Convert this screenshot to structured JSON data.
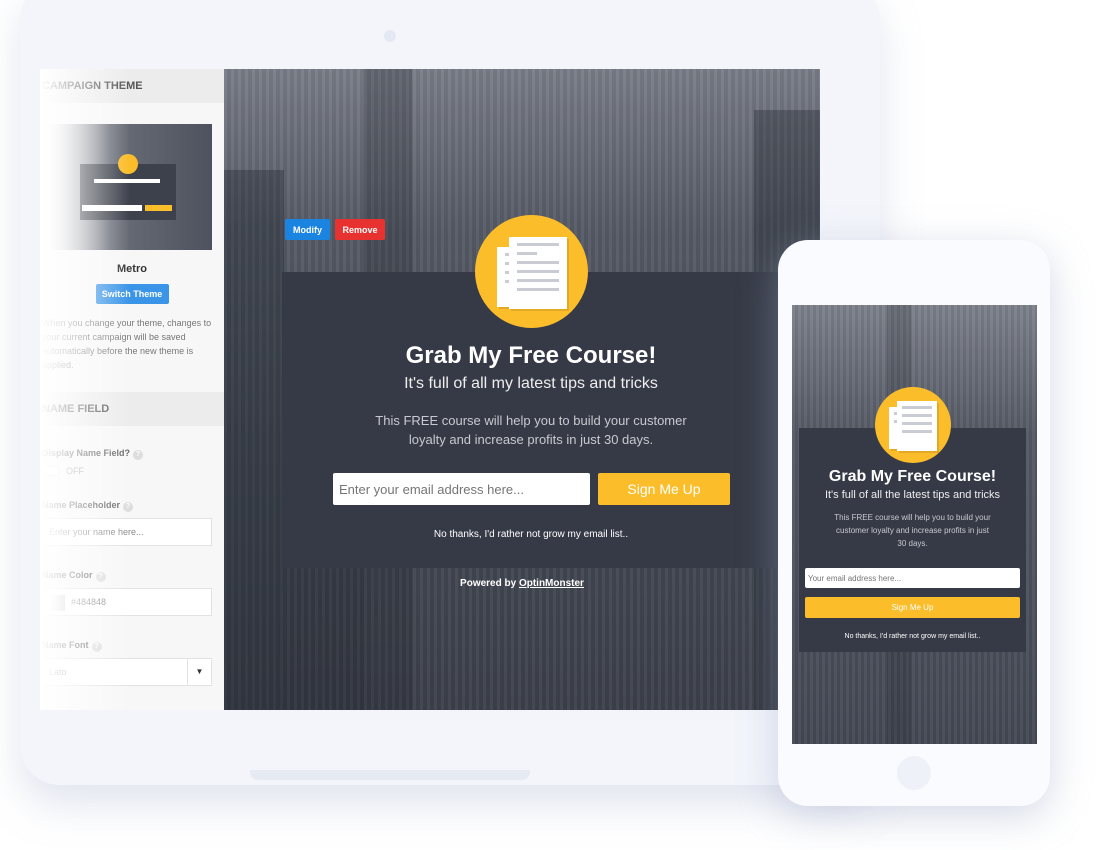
{
  "sidebar": {
    "campaign_theme": "CAMPAIGN THEME",
    "theme_name": "Metro",
    "switch_theme": "Switch Theme",
    "theme_note": "When you change your theme, changes to your current campaign will be saved automatically before the new theme is applied.",
    "name_field": "NAME FIELD",
    "display_name_label": "Display Name Field?",
    "toggle_state": "OFF",
    "placeholder_label": "Name Placeholder",
    "placeholder_value": "Enter your name here...",
    "color_label": "Name Color",
    "color_value": "#484848",
    "font_label": "Name Font",
    "font_value": "Lato"
  },
  "preview": {
    "modify": "Modify",
    "remove": "Remove",
    "title": "Grab My Free Course!",
    "subtitle": "It's full of all my latest tips and tricks",
    "body": "This FREE course will help you to build your customer loyalty and increase profits in just 30 days.",
    "email_placeholder": "Enter your email address here...",
    "signup": "Sign Me Up",
    "no_thanks": "No thanks, I'd rather not grow my email list..",
    "powered_by": "Powered by ",
    "brand": "OptinMonster"
  },
  "mobile": {
    "title": "Grab My Free Course!",
    "subtitle": "It's full of all the latest tips and tricks",
    "body": "This FREE course will help you to build your customer loyalty and increase profits in just 30 days.",
    "email_placeholder": "Your email address here...",
    "signup": "Sign Me Up",
    "no_thanks": "No thanks, I'd rather not grow my email list.."
  },
  "colors": {
    "accent_yellow": "#fbbd2a",
    "popup_bg": "#363a46",
    "modify_blue": "#1a84e0",
    "remove_red": "#e8322f",
    "switch_blue": "#3a95e8"
  }
}
